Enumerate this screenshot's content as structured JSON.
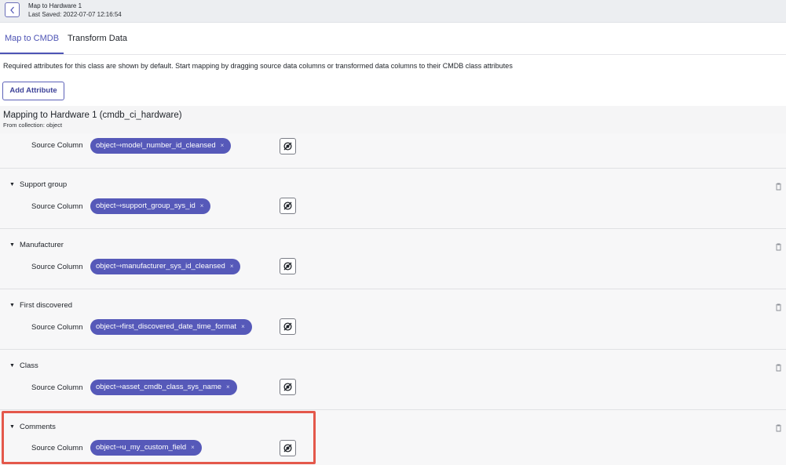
{
  "header": {
    "title": "Map to Hardware 1",
    "last_saved": "Last Saved: 2022-07-07 12:16:54"
  },
  "tabs": [
    {
      "label": "Map to CMDB",
      "active": true
    },
    {
      "label": "Transform Data",
      "active": false
    }
  ],
  "description": "Required attributes for this class are shown by default. Start mapping by dragging source data columns or transformed data columns to their CMDB class attributes",
  "add_attribute_label": "Add Attribute",
  "mapping": {
    "title": "Mapping to Hardware 1 (cmdb_ci_hardware)",
    "subtitle": "From collection: object"
  },
  "source_column_label": "Source Column",
  "chip_remove": "×",
  "toggle_icon": "▼",
  "first_row": {
    "chip": "object⇾model_number_id_cleansed"
  },
  "sections": [
    {
      "label": "Support group",
      "chip": "object⇾support_group_sys_id"
    },
    {
      "label": "Manufacturer",
      "chip": "object⇾manufacturer_sys_id_cleansed"
    },
    {
      "label": "First discovered",
      "chip": "object⇾first_discovered_date_time_format"
    },
    {
      "label": "Class",
      "chip": "object⇾asset_cmdb_class_sys_name"
    },
    {
      "label": "Comments",
      "chip": "object⇾u_my_custom_field"
    }
  ],
  "colors": {
    "accent": "#4e54b5",
    "chip": "#5659b9",
    "highlight": "#e4584b"
  },
  "icons": {
    "back": "chevron-left-icon",
    "map_button": "map-target-icon",
    "delete": "trash-icon",
    "toggle": "caret-down-icon"
  }
}
